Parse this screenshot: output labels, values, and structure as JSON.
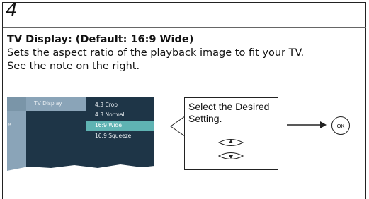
{
  "step": {
    "number": "4"
  },
  "section": {
    "heading": "TV Display: (Default: 16:9 Wide)",
    "description_line1": "Sets the aspect ratio of the playback image to fit your TV.",
    "description_line2": "See the note on the right."
  },
  "menu": {
    "tab_label": "TV Display",
    "left_fragment": "e",
    "options": [
      {
        "label": "4:3 Crop",
        "selected": false
      },
      {
        "label": "4:3 Normal",
        "selected": false
      },
      {
        "label": "16:9 Wide",
        "selected": true
      },
      {
        "label": "16:9 Squeeze",
        "selected": false
      }
    ],
    "colors": {
      "dark_panel": "#1e3547",
      "light_panel": "#8aa4b8",
      "selection": "#5fb3b3"
    }
  },
  "callout": {
    "text": "Select the Desired Setting.",
    "up_icon": "up-arrow-button-icon",
    "down_icon": "down-arrow-button-icon"
  },
  "ok_button": {
    "label": "OK"
  }
}
